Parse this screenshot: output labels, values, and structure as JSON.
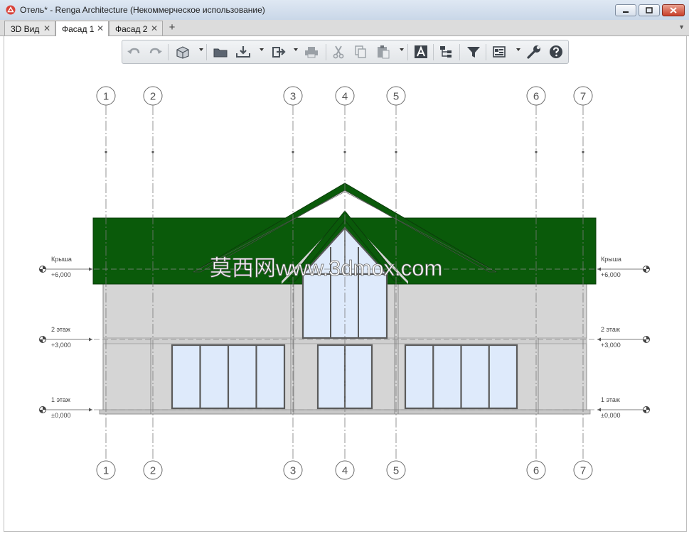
{
  "window": {
    "title": "Отель* - Renga Architecture (Некоммерческое использование)"
  },
  "tabs": [
    {
      "label": "3D Вид"
    },
    {
      "label": "Фасад 1"
    },
    {
      "label": "Фасад 2"
    }
  ],
  "tab_close_glyph": "✕",
  "tab_add_glyph": "+",
  "tab_menu_glyph": "▼",
  "toolbar": {
    "icons": [
      "undo-icon",
      "redo-icon",
      "view-cube-icon",
      "open-folder-icon",
      "import-icon",
      "export-icon",
      "print-icon",
      "cut-icon",
      "copy-icon",
      "paste-icon",
      "text-icon",
      "layers-icon",
      "filter-icon",
      "display-settings-icon",
      "wrench-icon",
      "help-icon"
    ]
  },
  "grid_axes": {
    "labels": [
      "1",
      "2",
      "3",
      "4",
      "5",
      "6",
      "7"
    ]
  },
  "levels": [
    {
      "name": "Крыша",
      "mark": "+6,000"
    },
    {
      "name": "2 этаж",
      "mark": "+3,000"
    },
    {
      "name": "1 этаж",
      "mark": "±0,000"
    }
  ],
  "watermark": "莫西网www.3dmox.com",
  "colors": {
    "roof": "#0a5a0a",
    "wall": "#d5d5d5",
    "glass": "#deeafb",
    "frame": "#5a5a5a"
  }
}
